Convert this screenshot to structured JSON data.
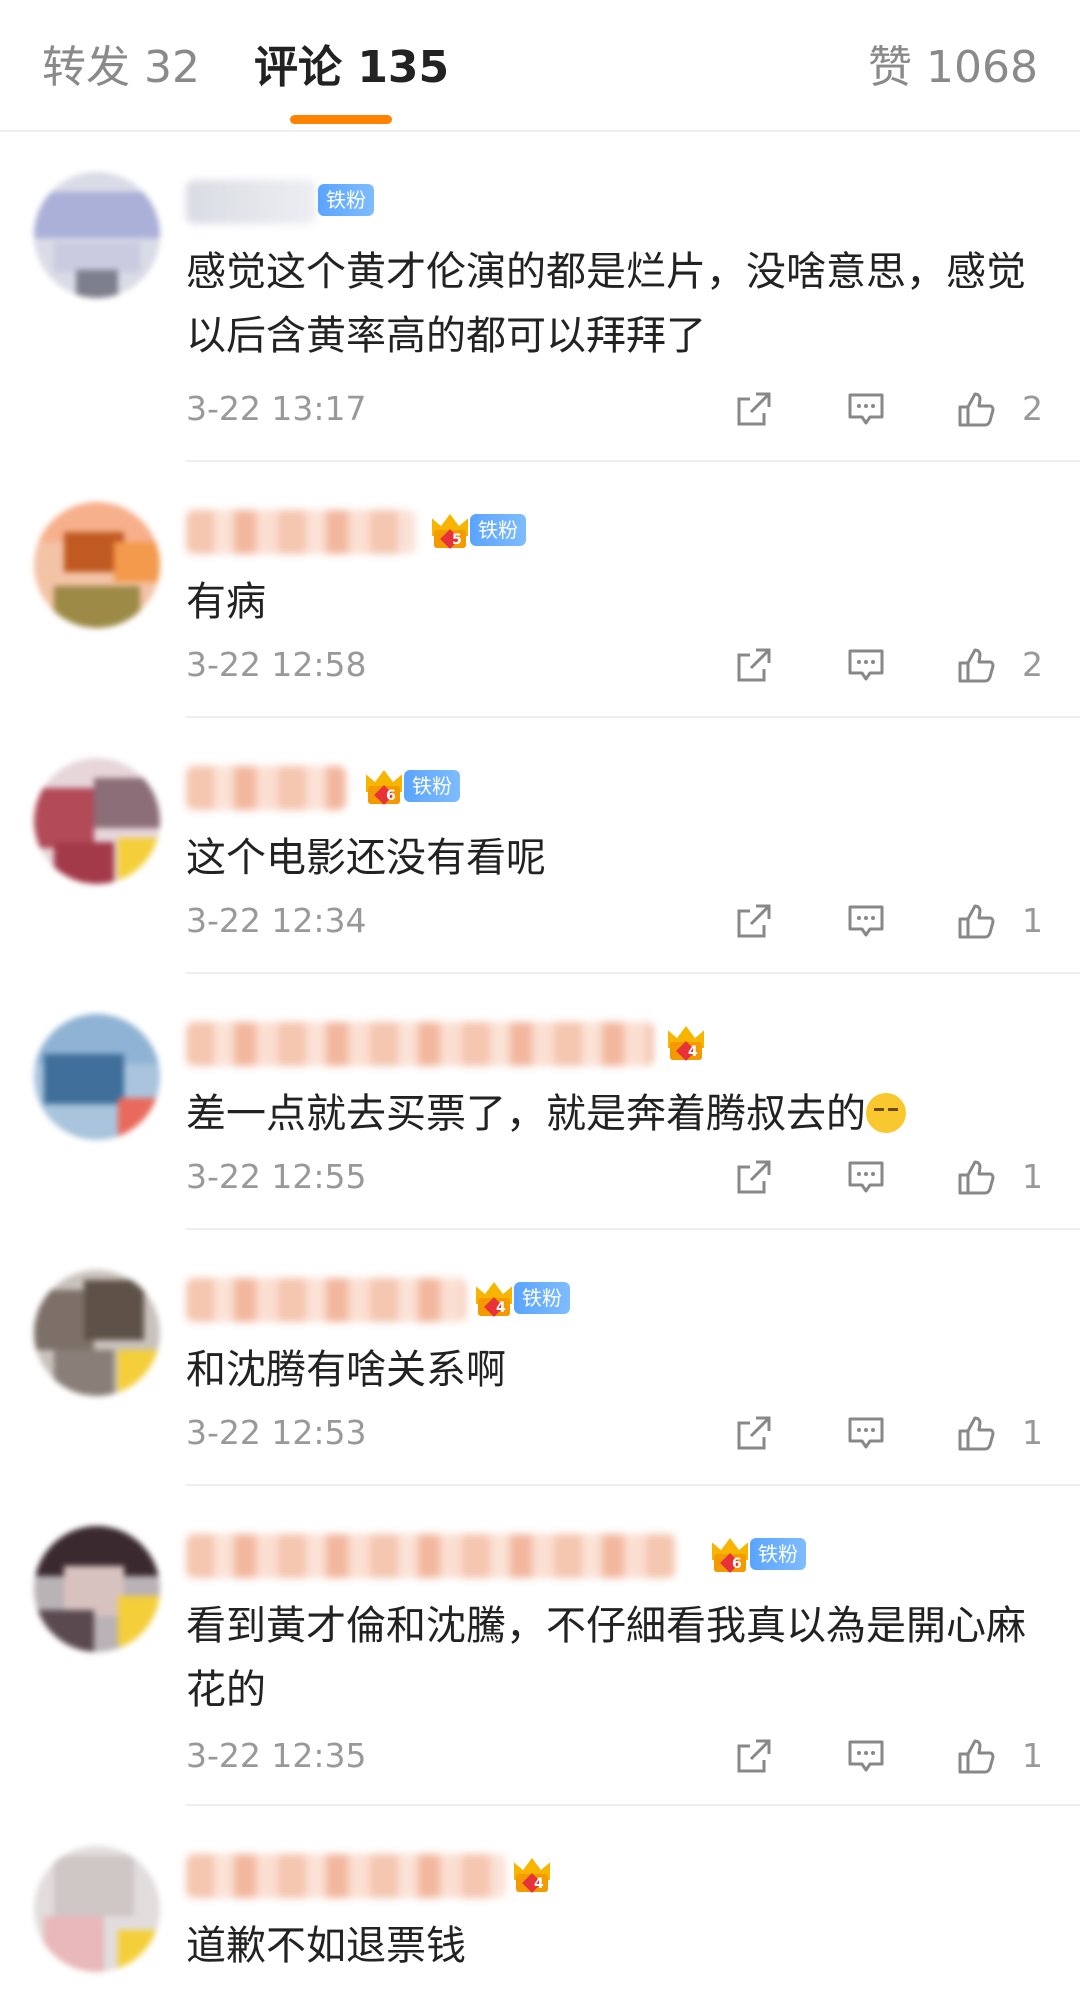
{
  "tabs": {
    "repost": "转发 32",
    "comments": "评论 135",
    "likes": "赞 1068"
  },
  "colors": {
    "accent": "#ff8200",
    "fan_badge": "#5aa4ff",
    "crown": "#f7b500"
  },
  "comments": [
    {
      "text": "感觉这个黄才伦演的都是烂片，没啥意思，感觉以后含黄率高的都可以拜拜了",
      "time": "3-22 13:17",
      "likes": "2",
      "badge_label": "铁粉",
      "crown_level": ""
    },
    {
      "text": "有病",
      "time": "3-22 12:58",
      "likes": "2",
      "badge_label": "铁粉",
      "crown_level": "5"
    },
    {
      "text": "这个电影还没有看呢",
      "time": "3-22 12:34",
      "likes": "1",
      "badge_label": "铁粉",
      "crown_level": "6"
    },
    {
      "text": "差一点就去买票了，就是奔着腾叔去的",
      "time": "3-22 12:55",
      "likes": "1",
      "badge_label": "",
      "crown_level": "4"
    },
    {
      "text": "和沈腾有啥关系啊",
      "time": "3-22 12:53",
      "likes": "1",
      "badge_label": "铁粉",
      "crown_level": "4"
    },
    {
      "text": "看到黃才倫和沈騰，不仔細看我真以為是開心麻花的",
      "time": "3-22 12:35",
      "likes": "1",
      "badge_label": "铁粉",
      "crown_level": "6"
    },
    {
      "text": "道歉不如退票钱",
      "time": "",
      "likes": "",
      "badge_label": "",
      "crown_level": "4"
    }
  ],
  "icons": {
    "share": "share-icon",
    "reply": "comment-icon",
    "like": "thumbs-up-icon",
    "emoji": "smirk-emoji-icon",
    "crown": "crown-icon"
  }
}
